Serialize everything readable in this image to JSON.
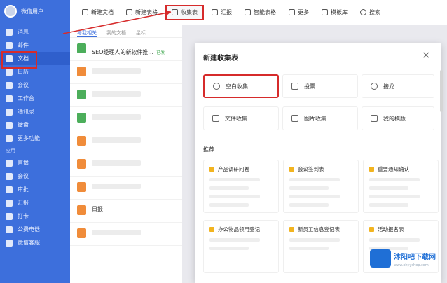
{
  "sidebar": {
    "user": "微信用户",
    "items": [
      {
        "label": "消息"
      },
      {
        "label": "邮件"
      },
      {
        "label": "文档"
      },
      {
        "label": "日历"
      },
      {
        "label": "会议"
      },
      {
        "label": "工作台"
      },
      {
        "label": "通讯录"
      },
      {
        "label": "微盘"
      },
      {
        "label": "更多功能"
      }
    ],
    "section_label": "应用",
    "apps": [
      {
        "label": "直播"
      },
      {
        "label": "会议"
      },
      {
        "label": "审批"
      },
      {
        "label": "汇报"
      },
      {
        "label": "打卡"
      },
      {
        "label": "公费电话"
      },
      {
        "label": "微信客服"
      }
    ],
    "active_index": 2
  },
  "toolbar": {
    "items": [
      {
        "label": "新建文档",
        "icon": "doc-icon"
      },
      {
        "label": "新建表格",
        "icon": "table-icon"
      },
      {
        "label": "收集表",
        "icon": "form-icon"
      },
      {
        "label": "汇报",
        "icon": "report-icon"
      },
      {
        "label": "智能表格",
        "icon": "smart-table-icon"
      },
      {
        "label": "更多",
        "icon": "more-icon"
      },
      {
        "label": "模板库",
        "icon": "template-icon"
      },
      {
        "label": "搜索",
        "icon": "search-icon"
      }
    ]
  },
  "tabs": [
    {
      "label": "与我相关"
    },
    {
      "label": "我的文档"
    },
    {
      "label": "星标"
    }
  ],
  "docs": [
    {
      "title": "SEO经理人的新软件推...",
      "badge": "已发",
      "time": "",
      "color": "green"
    },
    {
      "title": "",
      "badge": "",
      "time": "",
      "color": "orange"
    },
    {
      "title": "",
      "badge": "",
      "time": "",
      "color": "green"
    },
    {
      "title": "",
      "badge": "",
      "time": "",
      "color": "green"
    },
    {
      "title": "",
      "badge": "",
      "time": "",
      "color": "orange"
    },
    {
      "title": "",
      "badge": "",
      "time": "",
      "color": "orange"
    },
    {
      "title": "",
      "badge": "",
      "time": "",
      "color": "orange"
    },
    {
      "title": "日报",
      "badge": "",
      "time": "",
      "color": "orange"
    },
    {
      "title": "",
      "badge": "",
      "time": "",
      "color": "orange"
    }
  ],
  "modal": {
    "title": "新建收集表",
    "close": "×",
    "cards": [
      {
        "label": "空白收集",
        "icon": "plus-circle-icon"
      },
      {
        "label": "投票",
        "icon": "bar-chart-icon"
      },
      {
        "label": "接龙",
        "icon": "relay-icon"
      },
      {
        "label": "文件收集",
        "icon": "folder-icon"
      },
      {
        "label": "图片收集",
        "icon": "image-icon"
      },
      {
        "label": "我的模版",
        "icon": "template-icon"
      }
    ],
    "recommend_label": "推荐",
    "templates": [
      {
        "title": "产品调研问卷"
      },
      {
        "title": "会议签到表"
      },
      {
        "title": "重要通知确认"
      },
      {
        "title": "办公物品领用登记"
      },
      {
        "title": "新员工信息登记表"
      },
      {
        "title": "活动报名表"
      }
    ]
  },
  "watermark": {
    "text": "沐阳吧下载网",
    "sub": "www.xhyyshop.com"
  }
}
